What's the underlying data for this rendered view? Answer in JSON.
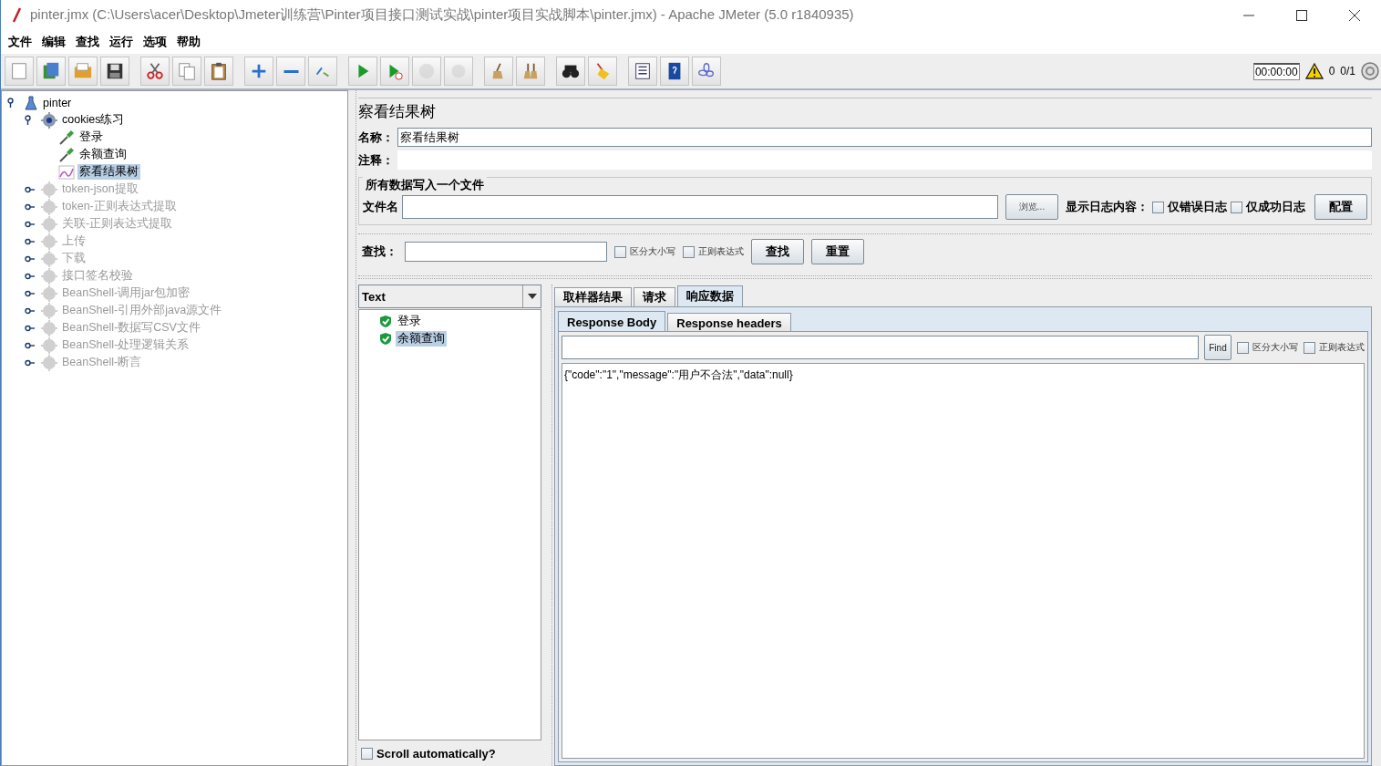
{
  "window": {
    "title": "pinter.jmx (C:\\Users\\acer\\Desktop\\Jmeter训练营\\Pinter项目接口测试实战\\pinter项目实战脚本\\pinter.jmx) - Apache JMeter (5.0 r1840935)"
  },
  "menu": [
    "文件",
    "编辑",
    "查找",
    "运行",
    "选项",
    "帮助"
  ],
  "toolbar": [
    [
      {
        "kind": "new",
        "disabled": false
      },
      {
        "kind": "templates",
        "disabled": false
      },
      {
        "kind": "open",
        "disabled": false
      },
      {
        "kind": "save",
        "disabled": false
      }
    ],
    [
      {
        "kind": "cut",
        "disabled": false
      },
      {
        "kind": "copy",
        "disabled": false
      },
      {
        "kind": "paste",
        "disabled": false
      }
    ],
    [
      {
        "kind": "expand",
        "disabled": false
      },
      {
        "kind": "collapse",
        "disabled": false
      },
      {
        "kind": "toggle",
        "disabled": false
      }
    ],
    [
      {
        "kind": "start",
        "disabled": false
      },
      {
        "kind": "start-no-pause",
        "disabled": false
      },
      {
        "kind": "stop",
        "disabled": true
      },
      {
        "kind": "shutdown",
        "disabled": true
      }
    ],
    [
      {
        "kind": "clear",
        "disabled": false
      },
      {
        "kind": "clear-all",
        "disabled": false
      }
    ],
    [
      {
        "kind": "search",
        "disabled": false
      },
      {
        "kind": "reset-search",
        "disabled": false
      }
    ],
    [
      {
        "kind": "function-helper",
        "disabled": false
      },
      {
        "kind": "help",
        "disabled": false
      },
      {
        "kind": "log-viewer",
        "disabled": false
      }
    ]
  ],
  "status": {
    "timer": "00:00:00",
    "warnings": "0",
    "threads": "0/1"
  },
  "tree": {
    "label": "pinter",
    "kind": "plan",
    "expanded": true,
    "selected": false,
    "disabled": false,
    "children": [
      {
        "label": "cookies练习",
        "kind": "thread-group",
        "expanded": true,
        "selected": false,
        "disabled": false,
        "children": [
          {
            "label": "登录",
            "kind": "sampler",
            "selected": false,
            "disabled": false
          },
          {
            "label": "余额查询",
            "kind": "sampler",
            "selected": false,
            "disabled": false
          },
          {
            "label": "察看结果树",
            "kind": "listener",
            "selected": true,
            "disabled": false
          }
        ]
      },
      {
        "label": "token-json提取",
        "kind": "thread-group",
        "expanded": false,
        "selected": false,
        "disabled": true
      },
      {
        "label": "token-正则表达式提取",
        "kind": "thread-group",
        "expanded": false,
        "selected": false,
        "disabled": true
      },
      {
        "label": "关联-正则表达式提取",
        "kind": "thread-group",
        "expanded": false,
        "selected": false,
        "disabled": true
      },
      {
        "label": "上传",
        "kind": "thread-group",
        "expanded": false,
        "selected": false,
        "disabled": true
      },
      {
        "label": "下载",
        "kind": "thread-group",
        "expanded": false,
        "selected": false,
        "disabled": true
      },
      {
        "label": "接口签名校验",
        "kind": "thread-group",
        "expanded": false,
        "selected": false,
        "disabled": true
      },
      {
        "label": "BeanShell-调用jar包加密",
        "kind": "thread-group",
        "expanded": false,
        "selected": false,
        "disabled": true
      },
      {
        "label": "BeanShell-引用外部java源文件",
        "kind": "thread-group",
        "expanded": false,
        "selected": false,
        "disabled": true
      },
      {
        "label": "BeanShell-数据写CSV文件",
        "kind": "thread-group",
        "expanded": false,
        "selected": false,
        "disabled": true
      },
      {
        "label": "BeanShell-处理逻辑关系",
        "kind": "thread-group",
        "expanded": false,
        "selected": false,
        "disabled": true
      },
      {
        "label": "BeanShell-断言",
        "kind": "thread-group",
        "expanded": false,
        "selected": false,
        "disabled": true
      }
    ]
  },
  "panel": {
    "title": "察看结果树",
    "name_label": "名称：",
    "name_value": "察看结果树",
    "comment_label": "注释：",
    "file_group": {
      "title": "所有数据写入一个文件",
      "file_label": "文件名",
      "browse": "浏览...",
      "log_label": "显示日志内容：",
      "options": [
        {
          "label": "仅错误日志",
          "checked": false
        },
        {
          "label": "仅成功日志",
          "checked": false
        }
      ],
      "configure": "配置"
    },
    "search": {
      "label": "查找：",
      "options": [
        {
          "label": "区分大小写",
          "checked": false
        },
        {
          "label": "正则表达式",
          "checked": false
        }
      ],
      "buttons": [
        "查找",
        "重置"
      ]
    }
  },
  "results": {
    "renderer": "Text",
    "items": [
      {
        "label": "登录",
        "success": true,
        "selected": false
      },
      {
        "label": "余额查询",
        "success": true,
        "selected": true
      }
    ],
    "scroll_auto": {
      "label": "Scroll automatically?",
      "checked": false
    }
  },
  "tabs": [
    {
      "label": "取样器结果",
      "selected": false
    },
    {
      "label": "请求",
      "selected": false
    },
    {
      "label": "响应数据",
      "selected": true
    }
  ],
  "subtabs": [
    {
      "label": "Response Body",
      "selected": true
    },
    {
      "label": "Response headers",
      "selected": false
    }
  ],
  "find": {
    "button": "Find",
    "options": [
      {
        "label": "区分大小写",
        "checked": false
      },
      {
        "label": "正则表达式",
        "checked": false
      }
    ]
  },
  "body": "{\"code\":\"1\",\"message\":\"用户不合法\",\"data\":null}"
}
